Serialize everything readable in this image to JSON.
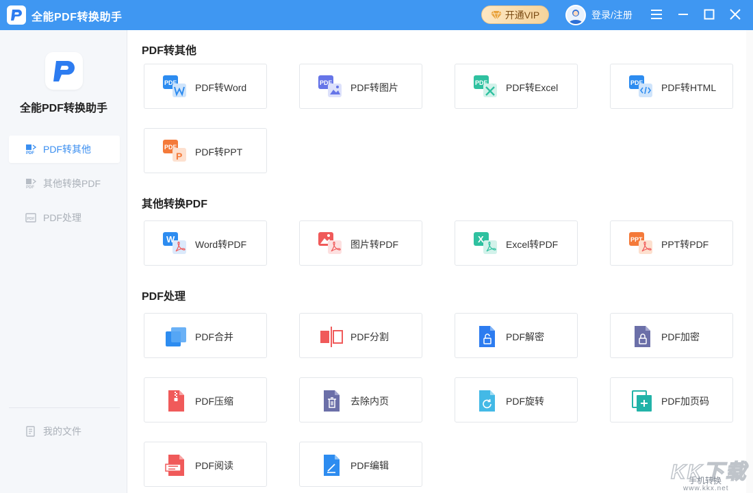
{
  "titlebar": {
    "app_title": "全能PDF转换助手",
    "vip_label": "开通VIP",
    "login_label": "登录/注册",
    "icons": [
      "menu-icon",
      "minimize-icon",
      "maximize-icon",
      "close-icon"
    ]
  },
  "sidebar": {
    "app_name": "全能PDF转换助手",
    "items": [
      {
        "label": "PDF转其他",
        "icon": "pdf-convert-icon",
        "active": true
      },
      {
        "label": "其他转换PDF",
        "icon": "to-pdf-icon",
        "active": false
      },
      {
        "label": "PDF处理",
        "icon": "pdf-process-icon",
        "active": false
      }
    ],
    "my_files": "我的文件"
  },
  "sections": [
    {
      "title": "PDF转其他",
      "cards": [
        {
          "label": "PDF转Word",
          "icon": "pdf-to-word-icon",
          "color": "#2d8cf0"
        },
        {
          "label": "PDF转图片",
          "icon": "pdf-to-image-icon",
          "color": "#6675e8"
        },
        {
          "label": "PDF转Excel",
          "icon": "pdf-to-excel-icon",
          "color": "#2fc1a0"
        },
        {
          "label": "PDF转HTML",
          "icon": "pdf-to-html-icon",
          "color": "#2d8cf0"
        },
        {
          "label": "PDF转PPT",
          "icon": "pdf-to-ppt-icon",
          "color": "#f47a3a"
        }
      ]
    },
    {
      "title": "其他转换PDF",
      "cards": [
        {
          "label": "Word转PDF",
          "icon": "word-to-pdf-icon",
          "color": "#2d8cf0"
        },
        {
          "label": "图片转PDF",
          "icon": "image-to-pdf-icon",
          "color": "#f05a5a"
        },
        {
          "label": "Excel转PDF",
          "icon": "excel-to-pdf-icon",
          "color": "#2fc1a0"
        },
        {
          "label": "PPT转PDF",
          "icon": "ppt-to-pdf-icon",
          "color": "#f47a3a"
        }
      ]
    },
    {
      "title": "PDF处理",
      "cards": [
        {
          "label": "PDF合并",
          "icon": "pdf-merge-icon",
          "color": "#2d8cf0"
        },
        {
          "label": "PDF分割",
          "icon": "pdf-split-icon",
          "color": "#f05a5a"
        },
        {
          "label": "PDF解密",
          "icon": "pdf-decrypt-icon",
          "color": "#2d7cf0"
        },
        {
          "label": "PDF加密",
          "icon": "pdf-encrypt-icon",
          "color": "#6b6fa8"
        },
        {
          "label": "PDF压缩",
          "icon": "pdf-compress-icon",
          "color": "#f05a5a"
        },
        {
          "label": "去除内页",
          "icon": "remove-pages-icon",
          "color": "#6b6fa8"
        },
        {
          "label": "PDF旋转",
          "icon": "pdf-rotate-icon",
          "color": "#43b9e6"
        },
        {
          "label": "PDF加页码",
          "icon": "pdf-page-number-icon",
          "color": "#22b3a8"
        },
        {
          "label": "PDF阅读",
          "icon": "pdf-read-icon",
          "color": "#f05a5a"
        },
        {
          "label": "PDF编辑",
          "icon": "pdf-edit-icon",
          "color": "#2d8cf0"
        }
      ]
    }
  ],
  "watermark": {
    "big": "KK下载",
    "small": "手机转换",
    "url": "www.kkx.net"
  }
}
